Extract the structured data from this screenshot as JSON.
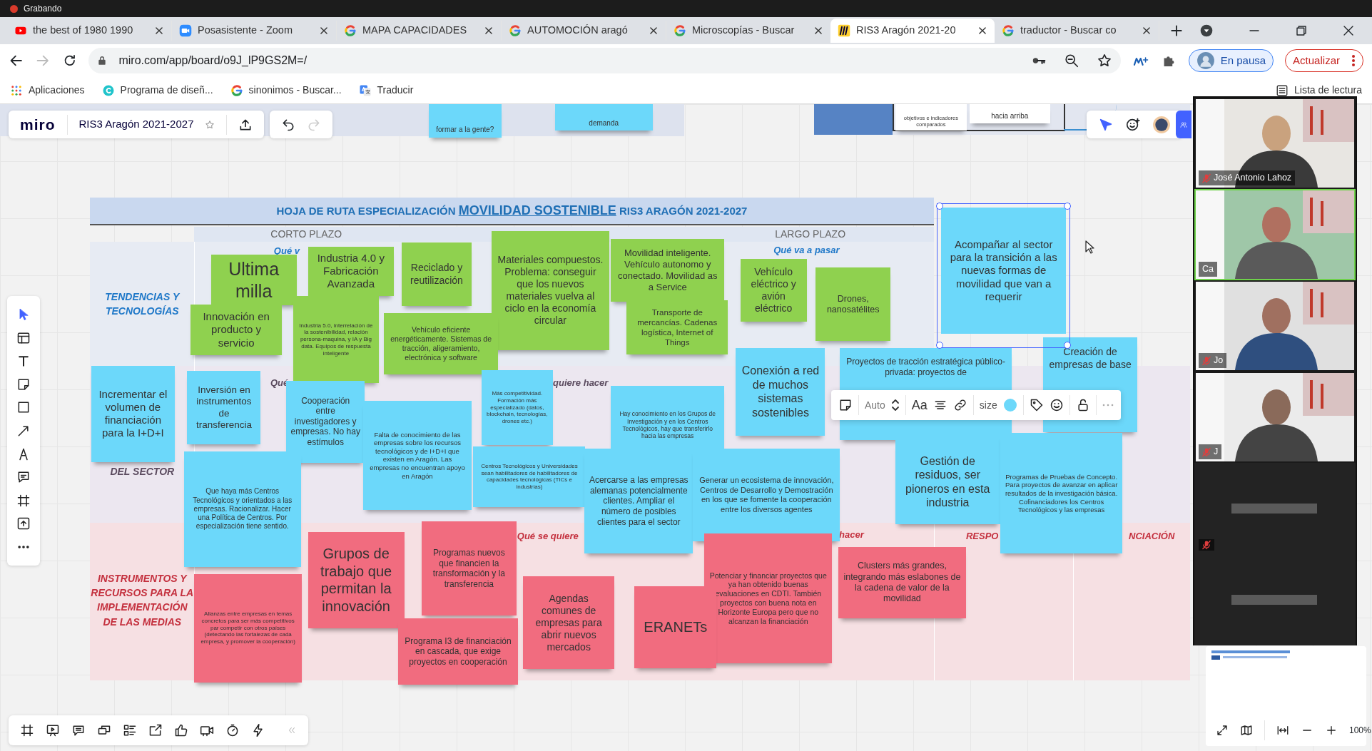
{
  "recording": {
    "label": "Grabando"
  },
  "tabs": [
    {
      "title": "the best of 1980 1990",
      "selected": false
    },
    {
      "title": "Posasistente - Zoom",
      "selected": false
    },
    {
      "title": "MAPA CAPACIDADES",
      "selected": false
    },
    {
      "title": "AUTOMOCIÓN aragó",
      "selected": false
    },
    {
      "title": "Microscopías - Buscar",
      "selected": false
    },
    {
      "title": "RIS3 Aragón 2021-20",
      "selected": true
    },
    {
      "title": "traductor - Buscar co",
      "selected": false
    }
  ],
  "address_bar": {
    "url": "miro.com/app/board/o9J_lP9GS2M=/"
  },
  "profile": {
    "status": "En pausa"
  },
  "update_button": {
    "label": "Actualizar"
  },
  "bookmarks": [
    {
      "label": "Aplicaciones"
    },
    {
      "label": "Programa de diseñ..."
    },
    {
      "label": "sinonimos - Buscar..."
    },
    {
      "label": "Traducir"
    }
  ],
  "reading_list": {
    "label": "Lista de lectura"
  },
  "board": {
    "logo": "miro",
    "name": "RIS3 Aragón 2021-2027",
    "zoom": "100%"
  },
  "background_notes": [
    "formar a la gente?",
    "demanda",
    "objetivos e indicadores comparados",
    "hacia arriba"
  ],
  "roadmap": {
    "title_before": "HOJA DE RUTA ESPECIALIZACIÓN",
    "title_highlight": "MOVILIDAD SOSTENIBLE",
    "title_after": "RIS3 ARAGÓN 2021-2027",
    "columns": [
      "CORTO PLAZO",
      "LARGO PLAZO"
    ],
    "rows": [
      {
        "label": "TENDENCIAS Y TECNOLOGÍAS",
        "color": "#1f78c8",
        "subheadings": [
          "Qué v",
          "Qué va a pasar"
        ]
      },
      {
        "label": "DEL SECTOR",
        "color": "#5a4a5e",
        "subheadings": [
          "Qué",
          "quiere hacer"
        ]
      },
      {
        "label": "INSTRUMENTOS Y RECURSOS PARA LA IMPLEMENTACIÓN DE LAS MEDIAS",
        "color": "#c4303e",
        "subheadings": [
          "Qué se quiere",
          "hacer",
          "RESPO",
          "NCIACIÓN"
        ]
      }
    ]
  },
  "sticky_notes": [
    {
      "text": "Ultima milla",
      "color": "#8fd14f",
      "selected": false
    },
    {
      "text": "Industria 4.0 y Fabricación Avanzada",
      "color": "#8fd14f",
      "selected": false
    },
    {
      "text": "Reciclado y reutilización",
      "color": "#8fd14f",
      "selected": false
    },
    {
      "text": "Materiales compuestos. Problema: conseguir que los nuevos materiales vuelva al ciclo en la economía circular",
      "color": "#8fd14f",
      "selected": false
    },
    {
      "text": "Movilidad inteligente. Vehículo autonomo y conectado. Movilidad as a Service",
      "color": "#8fd14f",
      "selected": false
    },
    {
      "text": "Transporte de mercancías. Cadenas logística, Internet of Things",
      "color": "#8fd14f",
      "selected": false
    },
    {
      "text": "Vehículo eléctrico y avión eléctrico",
      "color": "#8fd14f",
      "selected": false
    },
    {
      "text": "Drones, nanosatélites",
      "color": "#8fd14f",
      "selected": false
    },
    {
      "text": "Innovación en producto y servicio",
      "color": "#8fd14f",
      "selected": false
    },
    {
      "text": "Industria 5.0, interrelación de la sostenibilidad, relación persona-maquina, y IA y Big data. Equipos de respuesta inteligente",
      "color": "#8fd14f",
      "selected": false
    },
    {
      "text": "Vehículo eficiente energéticamente. Sistemas de tracción, aligeramiento, electrónica y software",
      "color": "#8fd14f",
      "selected": false
    },
    {
      "text": "Incrementar el volumen de financiación para la I+D+I",
      "color": "#6cd8fa",
      "selected": false
    },
    {
      "text": "Inversión en instrumentos de transferencia",
      "color": "#6cd8fa",
      "selected": false
    },
    {
      "text": "Cooperación entre investigadores y empresas. No hay estímulos",
      "color": "#6cd8fa",
      "selected": false
    },
    {
      "text": "Falta de conocimiento de las empresas sobre los recursos tecnológicos y de I+D+I que existen en Aragón. Las empresas no encuentran apoyo en Aragón",
      "color": "#6cd8fa",
      "selected": false
    },
    {
      "text": "Más competitividad. Formación más especializado (datos, blockchain, tecnologías, drones etc.)",
      "color": "#6cd8fa",
      "selected": false
    },
    {
      "text": "Centros Tecnológicos y Universidades sean habilitadores de habilitadores de capacidades tecnológicas (TICs e industrias)",
      "color": "#6cd8fa",
      "selected": false
    },
    {
      "text": "Hay conocimiento en los Grupos de Investigación y en los Centros Tecnológicos, hay que transferirlo hacia las empresas",
      "color": "#6cd8fa",
      "selected": false
    },
    {
      "text": "Que haya más Centros Tecnológicos y orientados a las empresas. Racionalizar. Hacer una Política de Centros. Por especialización tiene sentido.",
      "color": "#6cd8fa",
      "selected": false
    },
    {
      "text": "Acercarse a las empresas alemanas potencialmente clientes. Ampliar el número de posibles clientes para el sector",
      "color": "#6cd8fa",
      "selected": false
    },
    {
      "text": "Conexión a red de muchos sistemas sostenibles",
      "color": "#6cd8fa",
      "selected": false
    },
    {
      "text": "Generar un ecosistema de innovación, Centros de Desarrollo y Demostración en los que se fomente la cooperación entre los diversos agentes",
      "color": "#6cd8fa",
      "selected": false
    },
    {
      "text": "Proyectos de tracción estratégica público-privada: proyectos de",
      "color": "#6cd8fa",
      "selected": false
    },
    {
      "text": "Creación de empresas de base",
      "color": "#6cd8fa",
      "selected": false
    },
    {
      "text": "Gestión de residuos, ser pioneros en esta industria",
      "color": "#6cd8fa",
      "selected": false
    },
    {
      "text": "Programas de Pruebas de Concepto. Para proyectos de avanzar en aplicar resultados de la investigación básica. Cofinanciadores los Centros Tecnológicos y las empresas",
      "color": "#6cd8fa",
      "selected": false
    },
    {
      "text": "Acompañar al sector para la transición a las nuevas formas de movilidad que van a requerir",
      "color": "#6cd8fa",
      "selected": true
    },
    {
      "text": "Alianzas entre empresas en temas concretos para ser más competitivos par competir con otros países (detectando las fortalezas de cada empresa, y promover la cooperación)",
      "color": "#f16c7f",
      "selected": false
    },
    {
      "text": "Grupos de trabajo que permitan la innovación",
      "color": "#f16c7f",
      "selected": false
    },
    {
      "text": "Programas nuevos que financien la transformación y la transferencia",
      "color": "#f16c7f",
      "selected": false
    },
    {
      "text": "Programa I3 de financiación en cascada, que exige proyectos en cooperación",
      "color": "#f16c7f",
      "selected": false
    },
    {
      "text": "Agendas comunes de empresas para abrir nuevos mercados",
      "color": "#f16c7f",
      "selected": false
    },
    {
      "text": "Potenciar y financiar proyectos que ya han obtenido buenas evaluaciones en CDTI. También proyectos con buena nota en Horizonte Europa pero que no alcanzan la financiación",
      "color": "#f16c7f",
      "selected": false
    },
    {
      "text": "ERANETs",
      "color": "#f16c7f",
      "selected": false
    },
    {
      "text": "Clusters más grandes, integrando más eslabones de la cadena de valor de la movilidad",
      "color": "#f16c7f",
      "selected": false
    }
  ],
  "context_toolbar": {
    "font_size": "Auto",
    "text_style": "Aa",
    "size_label": "size"
  },
  "participants": [
    {
      "name": "José Antonio Lahoz",
      "kind": "camera",
      "muted": true,
      "speaking": false
    },
    {
      "name": "Ca",
      "kind": "camera",
      "muted": false,
      "speaking": true
    },
    {
      "name": "Jo",
      "kind": "camera",
      "muted": true,
      "speaking": false
    },
    {
      "name": "J",
      "kind": "camera",
      "muted": true,
      "speaking": false
    },
    {
      "kind": "blank",
      "muted": true,
      "speaking": false
    },
    {
      "kind": "blank",
      "muted": false,
      "speaking": false
    }
  ]
}
